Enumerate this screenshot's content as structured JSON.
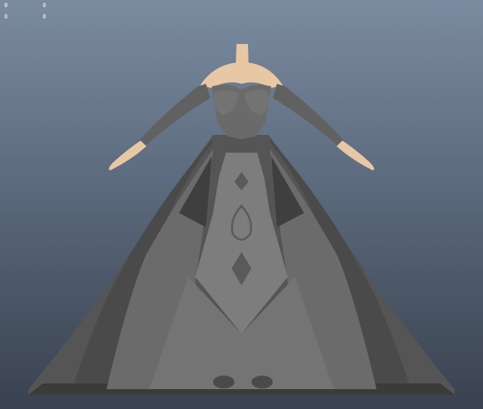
{
  "viewport": {
    "background_top": "#7b8ba0",
    "background_bottom": "#39424f"
  },
  "hud": {
    "rows": [
      [
        "0",
        "0"
      ],
      [
        "0",
        "0"
      ]
    ]
  },
  "model": {
    "skin_color": "#e8c8a4",
    "dress_color": "#666666",
    "dress_dark": "#3e3e3e",
    "panel_color": "#787878"
  }
}
